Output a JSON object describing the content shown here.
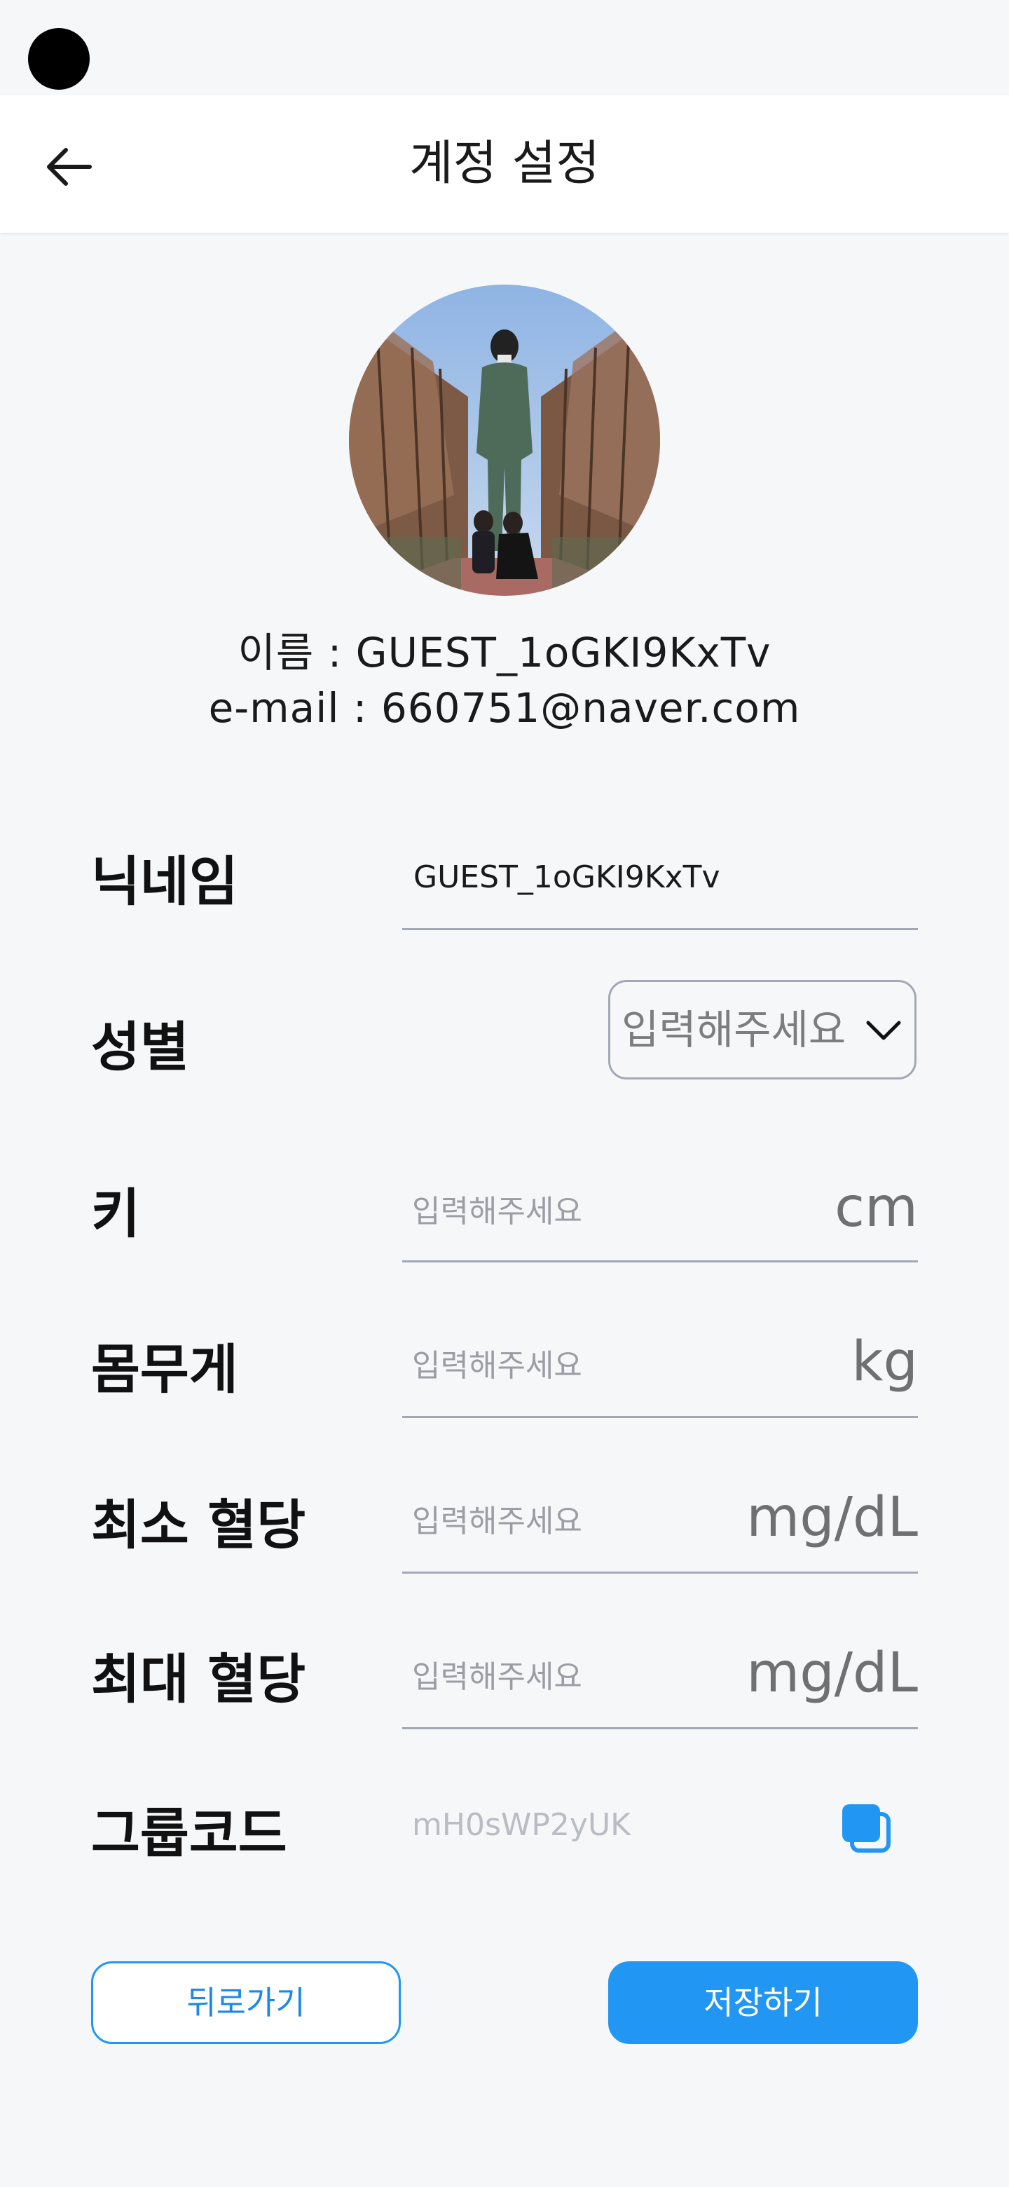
{
  "header": {
    "title": "계정 설정",
    "back_icon": "arrow-left-icon"
  },
  "profile": {
    "name_line": "이름 : GUEST_1oGKI9KxTv",
    "email_line": "e-mail : 660751@naver.com"
  },
  "form": {
    "nickname": {
      "label": "닉네임",
      "value": "GUEST_1oGKI9KxTv"
    },
    "gender": {
      "label": "성별",
      "selected": "입력해주세요",
      "icon": "chevron-down-icon"
    },
    "height": {
      "label": "키",
      "placeholder": "입력해주세요",
      "unit": "cm"
    },
    "weight": {
      "label": "몸무게",
      "placeholder": "입력해주세요",
      "unit": "kg"
    },
    "min_glucose": {
      "label": "최소 혈당",
      "placeholder": "입력해주세요",
      "unit": "mg/dL"
    },
    "max_glucose": {
      "label": "최대 혈당",
      "placeholder": "입력해주세요",
      "unit": "mg/dL"
    },
    "group_code": {
      "label": "그룹코드",
      "value": "mH0sWP2yUK",
      "icon": "copy-icon"
    }
  },
  "actions": {
    "back_label": "뒤로가기",
    "save_label": "저장하기"
  },
  "colors": {
    "accent": "#2196f3",
    "underline": "#a3a8b7",
    "background": "#f6f7f9"
  }
}
